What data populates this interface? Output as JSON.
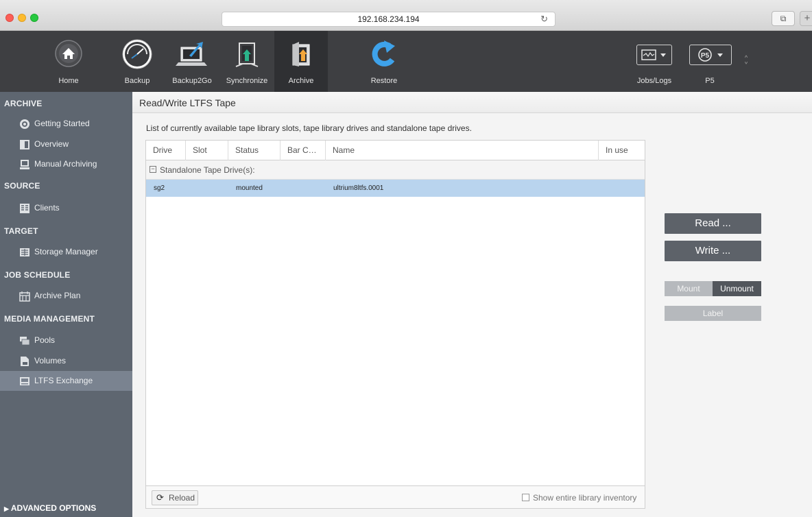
{
  "browser": {
    "url": "192.168.234.194",
    "reload_icon": "↻",
    "tabs_icon": "⧉",
    "new_tab_icon": "+"
  },
  "toolbar": {
    "items": [
      {
        "label": "Home",
        "icon": "home-icon"
      },
      {
        "label": "Backup",
        "icon": "gauge-icon"
      },
      {
        "label": "Backup2Go",
        "icon": "laptop-icon"
      },
      {
        "label": "Synchronize",
        "icon": "sync-icon"
      },
      {
        "label": "Archive",
        "icon": "archive-icon",
        "active": true
      },
      {
        "label": "Restore",
        "icon": "restore-icon"
      }
    ],
    "right": [
      {
        "label": "Jobs/Logs",
        "icon": "monitor-icon"
      },
      {
        "label": "P5",
        "icon": "p5-icon"
      }
    ],
    "p5_badge": "P5"
  },
  "sidebar": {
    "sections": [
      {
        "title": "ARCHIVE",
        "items": [
          "Getting Started",
          "Overview",
          "Manual Archiving"
        ]
      },
      {
        "title": "SOURCE",
        "items": [
          "Clients"
        ]
      },
      {
        "title": "TARGET",
        "items": [
          "Storage Manager"
        ]
      },
      {
        "title": "JOB SCHEDULE",
        "items": [
          "Archive Plan"
        ]
      },
      {
        "title": "MEDIA MANAGEMENT",
        "items": [
          "Pools",
          "Volumes",
          "LTFS Exchange"
        ]
      }
    ],
    "selected": "LTFS Exchange",
    "advanced": "ADVANCED OPTIONS"
  },
  "main": {
    "title": "Read/Write LTFS Tape",
    "description": "List of currently available tape library slots, tape library drives and standalone tape drives.",
    "columns": [
      "Drive",
      "Slot",
      "Status",
      "Bar C…",
      "Name",
      "In use"
    ],
    "group": "Standalone Tape Drive(s):",
    "rows": [
      {
        "drive": "sg2",
        "slot": "",
        "status": "mounted",
        "barcode": "",
        "name": "ultrium8ltfs.0001",
        "in_use": ""
      }
    ],
    "reload_label": "Reload",
    "inventory_label": "Show entire library inventory",
    "buttons": {
      "read": "Read ...",
      "write": "Write ...",
      "mount": "Mount",
      "unmount": "Unmount",
      "label": "Label"
    }
  }
}
